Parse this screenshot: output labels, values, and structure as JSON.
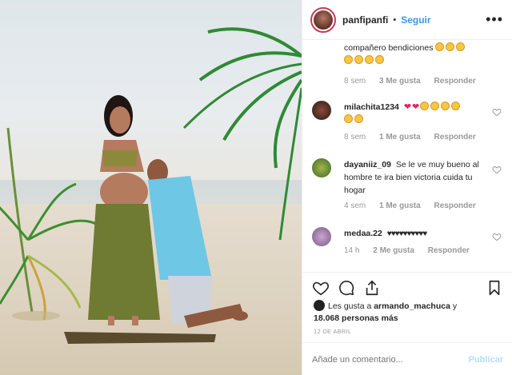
{
  "header": {
    "username": "panfipanfi",
    "separator": "•",
    "follow_label": "Seguir",
    "more_label": "•••"
  },
  "comments": [
    {
      "user": "",
      "text": "compañero bendiciones",
      "time": "8 sem",
      "likes": "3 Me gusta",
      "reply": "Responder"
    },
    {
      "user": "milachita1234",
      "text": "",
      "time": "8 sem",
      "likes": "1 Me gusta",
      "reply": "Responder"
    },
    {
      "user": "dayaniiz_09",
      "text": "Se le ve muy bueno al hombre te ira bien victoria cuida tu hogar",
      "time": "4 sem",
      "likes": "1 Me gusta",
      "reply": "Responder"
    },
    {
      "user": "medaa.22",
      "text": "♥♥♥♥♥♥♥♥♥♥",
      "time": "14 h",
      "likes": "2 Me gusta",
      "reply": "Responder"
    }
  ],
  "likes": {
    "prefix": "Les gusta a",
    "user": "armando_machuca",
    "conjunction": "y",
    "count": "18.068 personas más"
  },
  "date": "12 DE ABRIL",
  "add_comment": {
    "placeholder": "Añade un comentario...",
    "publish_label": "Publicar"
  },
  "colors": {
    "accent": "#3897f0",
    "muted": "#999999",
    "border": "#efefef",
    "heart": "#e0245e",
    "publish_disabled": "#b2dffc"
  }
}
